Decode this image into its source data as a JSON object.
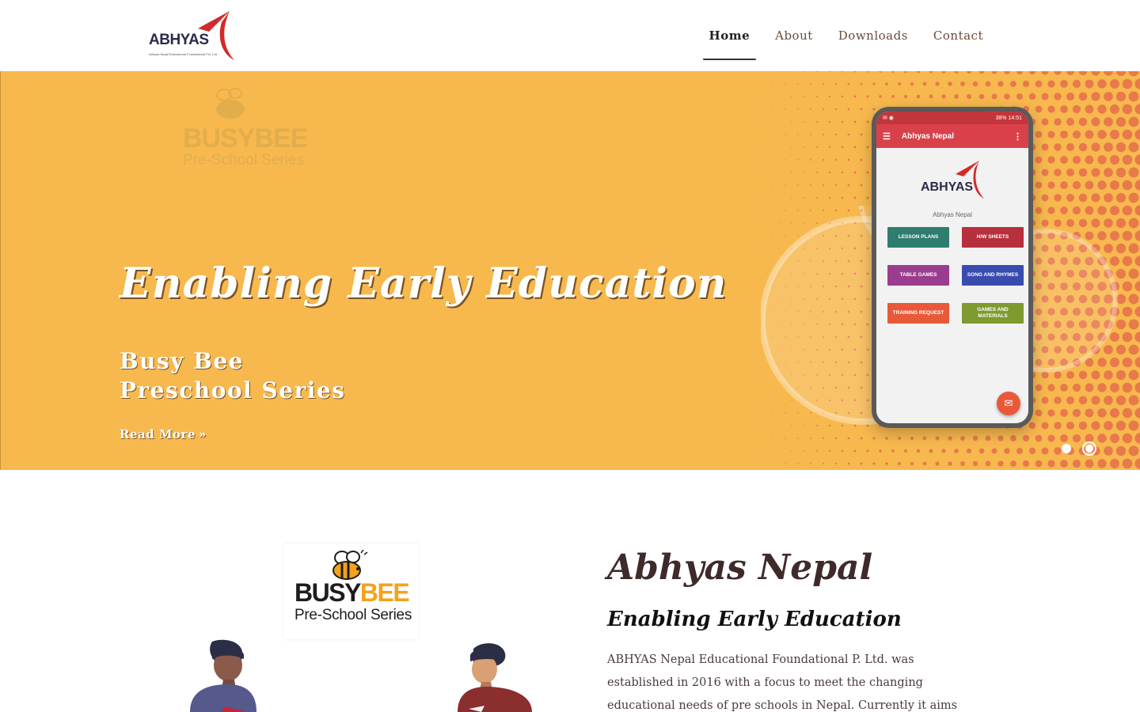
{
  "header": {
    "logo_text": "ABHYAS",
    "logo_subtext": "Abhyas Nepal Educational Foundational Pvt. Ltd.",
    "nav": [
      {
        "label": "Home",
        "active": true
      },
      {
        "label": "About",
        "active": false
      },
      {
        "label": "Downloads",
        "active": false
      },
      {
        "label": "Contact",
        "active": false
      }
    ]
  },
  "hero": {
    "watermark_title": "BUSYBEE",
    "watermark_subtitle": "Pre-School Series",
    "title": "Enabling Early Education",
    "subtitle": "Busy Bee Preschool Series",
    "link_label": "Read More",
    "link_icon": "double-chevron-right-icon",
    "background_color": "#f7b84e",
    "slides": [
      {
        "active": false
      },
      {
        "active": true
      }
    ]
  },
  "phone": {
    "status_left": "✉ ◉",
    "status_right": "38% 14:51",
    "app_bar_title": "Abhyas Nepal",
    "logo_text": "ABHYAS",
    "app_name": "Abhyas Nepal",
    "buttons": [
      {
        "label": "LESSON PLANS",
        "color": "#2f7d6e"
      },
      {
        "label": "H/W SHEETS",
        "color": "#b8303d"
      },
      {
        "label": "TABLE GAMES",
        "color": "#9b3d8f"
      },
      {
        "label": "SONG AND RHYMES",
        "color": "#3a4bb0"
      },
      {
        "label": "TRAINING REQUEST",
        "color": "#e8593a"
      },
      {
        "label": "GAMES AND MATERIALS",
        "color": "#7f9a2e"
      }
    ]
  },
  "about": {
    "logo_title_part1": "BUSY",
    "logo_title_part2": "BEE",
    "logo_subtitle": "Pre-School Series",
    "title": "Abhyas Nepal",
    "subtitle": "Enabling Early Education",
    "body": "ABHYAS Nepal Educational Foundational P. Ltd. was established in 2016 with a focus to meet the changing educational needs of pre schools in Nepal. Currently it aims to be known as a center"
  }
}
